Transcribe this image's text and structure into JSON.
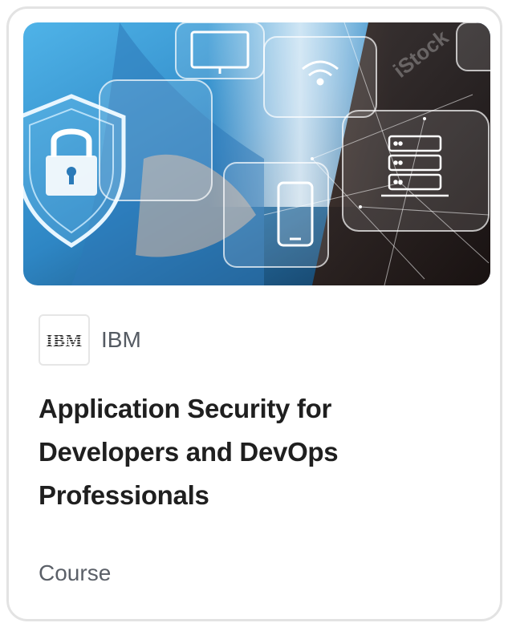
{
  "card": {
    "image_alt": "Application security illustration",
    "image_watermark": "iStock",
    "partner": {
      "logo_text": "IBM",
      "name": "IBM"
    },
    "title": "Application Security for Developers and DevOps Professionals",
    "type": "Course"
  },
  "colors": {
    "card_border": "#e3e3e3",
    "title": "#1f1f1f",
    "subtext": "#5b6068",
    "hero_blue": "#3a9ad6"
  },
  "icons": [
    "shield-lock-icon",
    "monitor-icon",
    "wifi-icon",
    "phone-icon",
    "server-icon"
  ]
}
